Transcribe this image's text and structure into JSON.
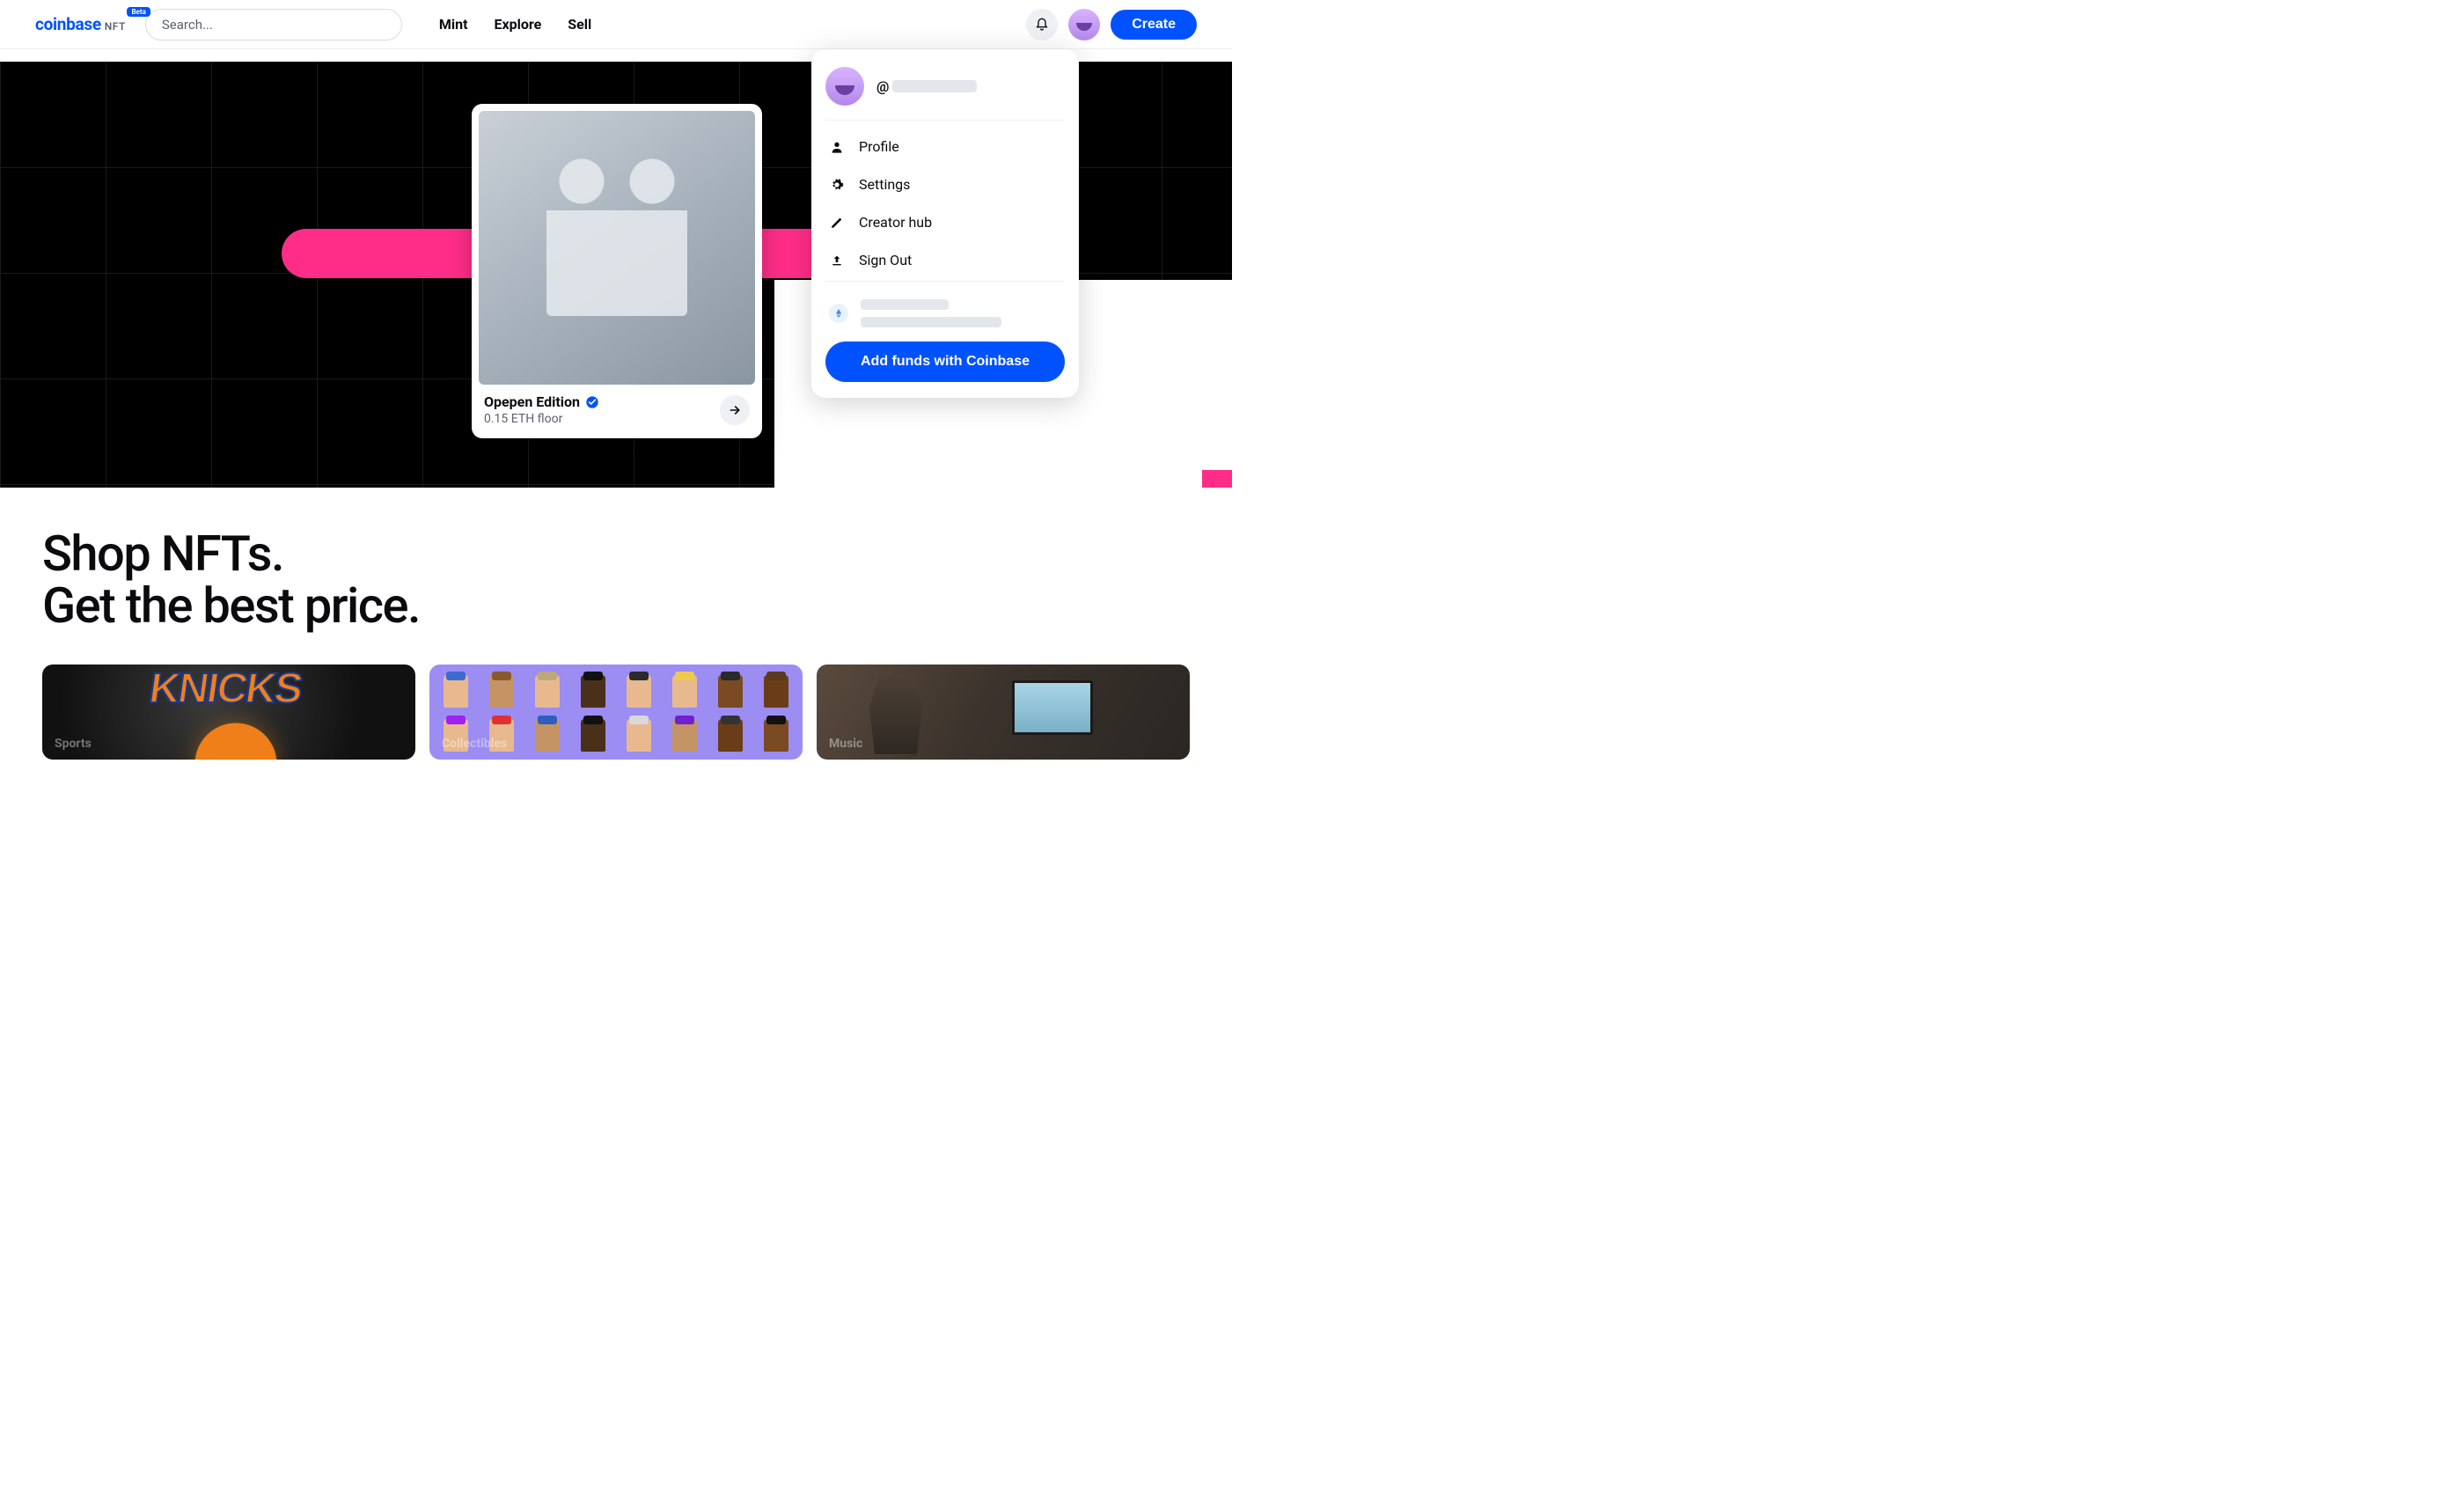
{
  "header": {
    "logo_main": "coinbase",
    "logo_sub": "NFT",
    "beta": "Beta",
    "search_placeholder": "Search...",
    "nav": [
      "Mint",
      "Explore",
      "Sell"
    ],
    "create": "Create"
  },
  "dropdown": {
    "handle_prefix": "@",
    "items": [
      {
        "icon": "person",
        "label": "Profile"
      },
      {
        "icon": "gear",
        "label": "Settings"
      },
      {
        "icon": "pencil",
        "label": "Creator hub"
      },
      {
        "icon": "signout",
        "label": "Sign Out"
      }
    ],
    "cta": "Add funds with Coinbase"
  },
  "hero": {
    "feature_title": "Opepen Edition",
    "feature_floor": "0.15 ETH floor"
  },
  "shop": {
    "heading_line1": "Shop NFTs.",
    "heading_line2": "Get the best price.",
    "categories": [
      {
        "label": "Sports"
      },
      {
        "label": "Collectibles"
      },
      {
        "label": "Music"
      }
    ]
  }
}
